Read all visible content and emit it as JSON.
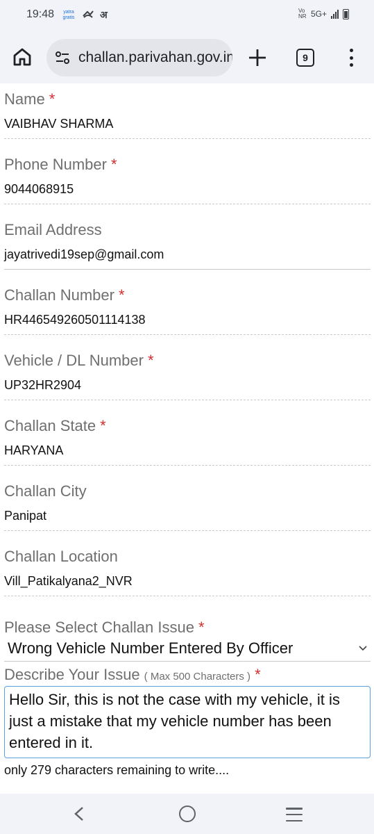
{
  "status": {
    "time": "19:48",
    "left_logo": "yatra gratis",
    "left_glyph": "अ",
    "network_small": "Vo NR",
    "network": "5G+"
  },
  "browser": {
    "url": "challan.parivahan.gov.in",
    "tab_count": "9"
  },
  "form": {
    "required_mark": "*",
    "fields": [
      {
        "label": "Name",
        "value": "VAIBHAV SHARMA",
        "required": "*"
      },
      {
        "label": "Phone Number",
        "value": "9044068915",
        "required": "*"
      },
      {
        "label": "Email Address",
        "value": "jayatrivedi19sep@gmail.com",
        "required": ""
      },
      {
        "label": "Challan Number",
        "value": "HR446549260501114138",
        "required": "*"
      },
      {
        "label": "Vehicle / DL Number",
        "value": "UP32HR2904",
        "required": "*"
      },
      {
        "label": "Challan State",
        "value": "HARYANA",
        "required": "*"
      },
      {
        "label": "Challan City",
        "value": "Panipat",
        "required": ""
      },
      {
        "label": "Challan Location",
        "value": "Vill_Patikalyana2_NVR",
        "required": ""
      }
    ],
    "issue_select": {
      "label": "Please Select Challan Issue",
      "required": "*",
      "value": "Wrong Vehicle Number Entered By Officer"
    },
    "describe": {
      "label": "Describe Your Issue",
      "hint": "( Max 500 Characters )",
      "required": "*",
      "text": "Hello Sir, this is not the case with my vehicle, it is just a mistake that my vehicle number has been entered in it.",
      "remaining": "only 279 characters remaining to write...."
    }
  },
  "icons": {
    "home": "home-icon",
    "site_settings": "tune-icon",
    "new_tab": "plus-icon",
    "menu": "more-vert-icon",
    "back": "nav-back-icon",
    "nav_home": "nav-home-icon",
    "recents": "nav-recents-icon"
  }
}
